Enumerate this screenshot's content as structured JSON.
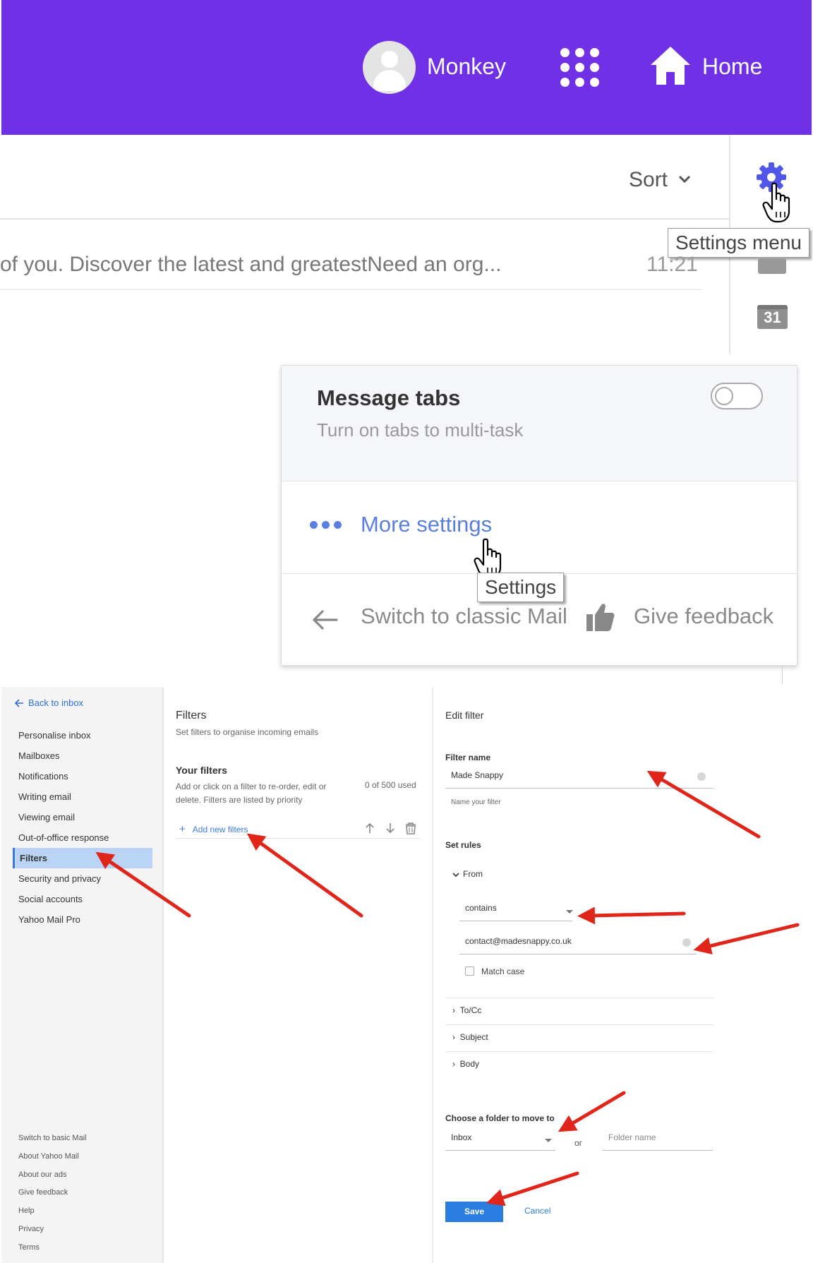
{
  "header": {
    "user_name": "Monkey",
    "home_label": "Home"
  },
  "inbox": {
    "sort_label": "Sort",
    "message_preview": "of you. Discover the latest and greatestNeed an org...",
    "message_time": "11:21",
    "calendar_day": "31"
  },
  "tooltips": {
    "settings_menu": "Settings menu",
    "settings": "Settings"
  },
  "settings_menu": {
    "message_tabs_title": "Message tabs",
    "message_tabs_subtitle": "Turn on tabs to multi-task",
    "more_settings": "More settings",
    "switch_classic": "Switch to classic Mail",
    "give_feedback": "Give feedback"
  },
  "sidebar": {
    "back_label": "Back to inbox",
    "items": [
      {
        "label": "Personalise inbox"
      },
      {
        "label": "Mailboxes"
      },
      {
        "label": "Notifications"
      },
      {
        "label": "Writing email"
      },
      {
        "label": "Viewing email"
      },
      {
        "label": "Out-of-office response"
      },
      {
        "label": "Filters"
      },
      {
        "label": "Security and privacy"
      },
      {
        "label": "Social accounts"
      },
      {
        "label": "Yahoo Mail Pro"
      }
    ],
    "footer": [
      {
        "label": "Switch to basic Mail"
      },
      {
        "label": "About Yahoo Mail"
      },
      {
        "label": "About our ads"
      },
      {
        "label": "Give feedback"
      },
      {
        "label": "Help"
      },
      {
        "label": "Privacy"
      },
      {
        "label": "Terms"
      }
    ]
  },
  "filters": {
    "title": "Filters",
    "subtitle": "Set filters to organise incoming emails",
    "your_filters": "Your filters",
    "description": "Add or click on a filter to re-order, edit or delete. Filters are listed by priority",
    "used": "0 of 500 used",
    "add_new": "Add new filters"
  },
  "edit_filter": {
    "title": "Edit filter",
    "filter_name_label": "Filter name",
    "filter_name_value": "Made Snappy",
    "filter_name_help": "Name your filter",
    "set_rules_label": "Set rules",
    "from_label": "From",
    "condition_value": "contains",
    "email_value": "contact@madesnappy.co.uk",
    "match_case_label": "Match case",
    "to_cc_label": "To/Cc",
    "subject_label": "Subject",
    "body_label": "Body",
    "folder_label": "Choose a folder to move to",
    "folder_value": "Inbox",
    "or_label": "or",
    "folder_name_placeholder": "Folder name",
    "save_label": "Save",
    "cancel_label": "Cancel"
  },
  "colors": {
    "header_purple": "#7030e6",
    "accent_blue": "#2b7de0",
    "annotation_red": "#e0251b"
  }
}
